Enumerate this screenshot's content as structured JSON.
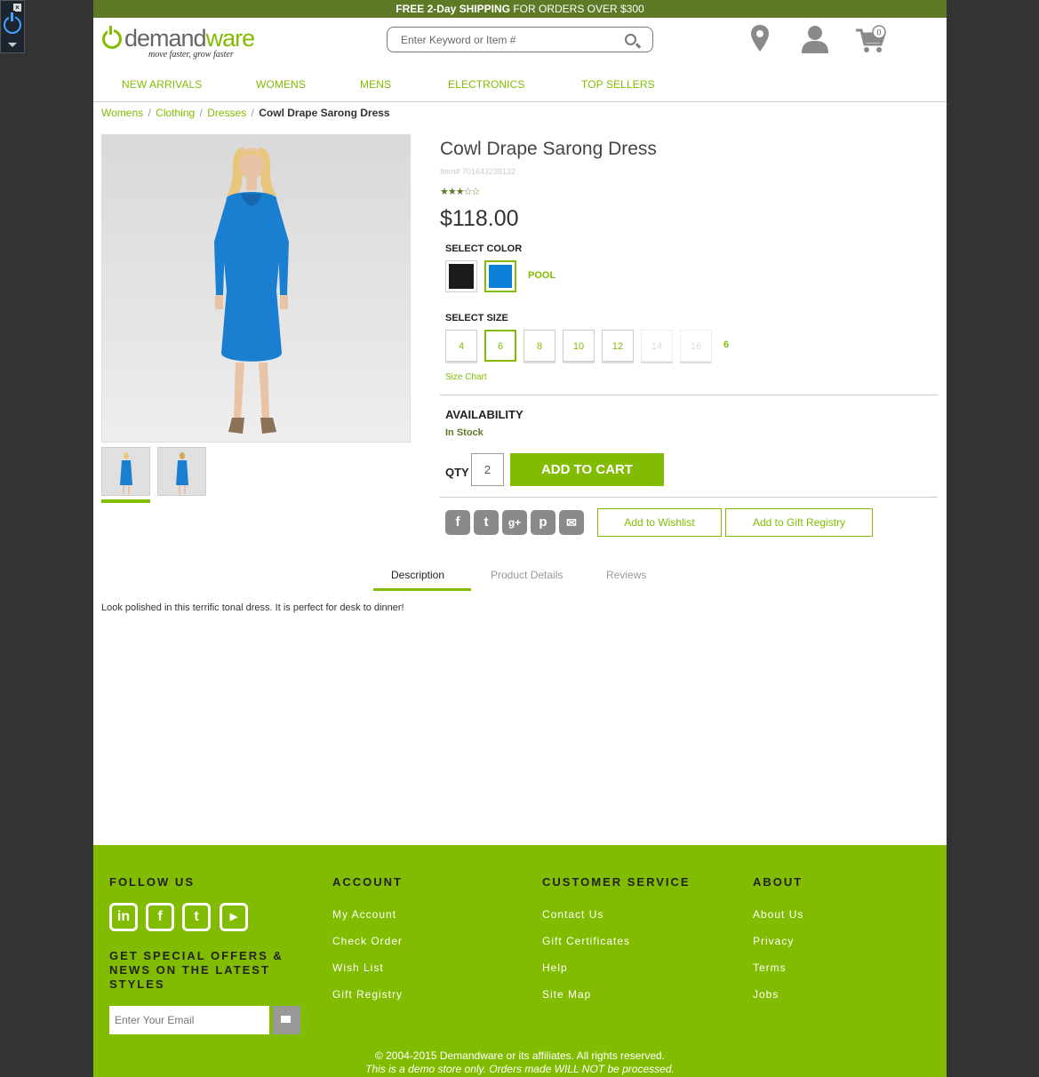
{
  "promo": {
    "bold": "FREE 2-Day SHIPPING",
    "rest": " FOR ORDERS OVER $300"
  },
  "logo": {
    "name_a": "demand",
    "name_b": "ware",
    "tagline": "move faster, grow faster"
  },
  "search": {
    "placeholder": "Enter Keyword or Item #"
  },
  "cart": {
    "count": "0"
  },
  "nav": [
    "NEW ARRIVALS",
    "WOMENS",
    "MENS",
    "ELECTRONICS",
    "TOP SELLERS"
  ],
  "breadcrumb": {
    "items": [
      "Womens",
      "Clothing",
      "Dresses"
    ],
    "current": "Cowl Drape Sarong Dress"
  },
  "product": {
    "name": "Cowl Drape Sarong Dress",
    "item": "Item# 701643238132",
    "rating": 2.5,
    "price": "$118.00",
    "select_color_label": "SELECT COLOR",
    "colors": [
      {
        "name": "black",
        "hex": "#1b1b1b"
      },
      {
        "name": "pool",
        "hex": "#0b80d6"
      }
    ],
    "selected_color": "POOL",
    "select_size_label": "SELECT SIZE",
    "sizes": [
      "4",
      "6",
      "8",
      "10",
      "12",
      "14",
      "16"
    ],
    "selected_size": "6",
    "size_chart": "Size Chart",
    "availability_label": "AVAILABILITY",
    "availability": "In Stock",
    "qty_label": "QTY",
    "qty": "2",
    "add_to_cart": "ADD TO CART",
    "wishlist": "Add to Wishlist",
    "gift_registry": "Add to Gift Registry"
  },
  "tabs": [
    "Description",
    "Product Details",
    "Reviews"
  ],
  "description": "Look polished in this terrific tonal dress. It is perfect for desk to dinner!",
  "footer": {
    "follow": "FOLLOW US",
    "offers": "GET SPECIAL OFFERS & NEWS ON THE LATEST STYLES",
    "email_placeholder": "Enter Your Email",
    "account": {
      "title": "ACCOUNT",
      "links": [
        "My Account",
        "Check Order",
        "Wish List",
        "Gift Registry"
      ]
    },
    "service": {
      "title": "CUSTOMER SERVICE",
      "links": [
        "Contact Us",
        "Gift Certificates",
        "Help",
        "Site Map"
      ]
    },
    "about": {
      "title": "ABOUT",
      "links": [
        "About Us",
        "Privacy",
        "Terms",
        "Jobs"
      ]
    },
    "copyright": "© 2004-2015 Demandware or its affiliates. All rights reserved.",
    "demo_note": "This is a demo store only. Orders made WILL NOT be processed."
  },
  "colors": {
    "brand_green": "#82bc00",
    "dark_green": "#5e7a26",
    "dress_blue": "#1a7fd1"
  }
}
